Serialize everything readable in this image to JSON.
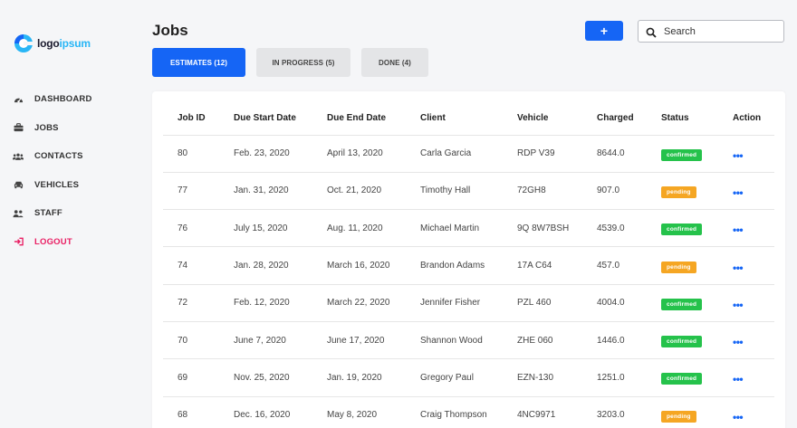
{
  "logo": {
    "part1": "logo",
    "part2": "ipsum",
    "colors": {
      "dark": "#1a1a2e",
      "accent": "#29b6f6"
    }
  },
  "nav": {
    "items": [
      {
        "label": "DASHBOARD",
        "icon": "dashboard-icon"
      },
      {
        "label": "JOBS",
        "icon": "briefcase-icon"
      },
      {
        "label": "CONTACTS",
        "icon": "users-icon"
      },
      {
        "label": "VEHICLES",
        "icon": "car-icon"
      },
      {
        "label": "STAFF",
        "icon": "user-group-icon"
      },
      {
        "label": "LOGOUT",
        "icon": "logout-icon"
      }
    ]
  },
  "header": {
    "title": "Jobs",
    "add_label": "+",
    "search_placeholder": "Search"
  },
  "tabs": [
    {
      "label": "ESTIMATES (12)",
      "active": true
    },
    {
      "label": "IN PROGRESS (5)",
      "active": false
    },
    {
      "label": "DONE (4)",
      "active": false
    }
  ],
  "table": {
    "columns": [
      "Job ID",
      "Due Start Date",
      "Due End Date",
      "Client",
      "Vehicle",
      "Charged",
      "Status",
      "Action"
    ],
    "rows": [
      {
        "id": "80",
        "start": "Feb. 23, 2020",
        "end": "April 13, 2020",
        "client": "Carla Garcia",
        "vehicle": "RDP V39",
        "charged": "8644.0",
        "status": "confirmed",
        "action": "•••"
      },
      {
        "id": "77",
        "start": "Jan. 31, 2020",
        "end": "Oct. 21, 2020",
        "client": "Timothy Hall",
        "vehicle": "72GH8",
        "charged": "907.0",
        "status": "pending",
        "action": "•••"
      },
      {
        "id": "76",
        "start": "July 15, 2020",
        "end": "Aug. 11, 2020",
        "client": "Michael Martin",
        "vehicle": "9Q 8W7BSH",
        "charged": "4539.0",
        "status": "confirmed",
        "action": "•••"
      },
      {
        "id": "74",
        "start": "Jan. 28, 2020",
        "end": "March 16, 2020",
        "client": "Brandon Adams",
        "vehicle": "17A C64",
        "charged": "457.0",
        "status": "pending",
        "action": "•••"
      },
      {
        "id": "72",
        "start": "Feb. 12, 2020",
        "end": "March 22, 2020",
        "client": "Jennifer Fisher",
        "vehicle": "PZL 460",
        "charged": "4004.0",
        "status": "confirmed",
        "action": "•••"
      },
      {
        "id": "70",
        "start": "June 7, 2020",
        "end": "June 17, 2020",
        "client": "Shannon Wood",
        "vehicle": "ZHE 060",
        "charged": "1446.0",
        "status": "confirmed",
        "action": "•••"
      },
      {
        "id": "69",
        "start": "Nov. 25, 2020",
        "end": "Jan. 19, 2020",
        "client": "Gregory Paul",
        "vehicle": "EZN-130",
        "charged": "1251.0",
        "status": "confirmed",
        "action": "•••"
      },
      {
        "id": "68",
        "start": "Dec. 16, 2020",
        "end": "May 8, 2020",
        "client": "Craig Thompson",
        "vehicle": "4NC9971",
        "charged": "3203.0",
        "status": "pending",
        "action": "•••"
      }
    ]
  },
  "colors": {
    "primary": "#1565f5",
    "confirmed": "#25c24b",
    "pending": "#f5a623",
    "logout": "#e91e63"
  }
}
